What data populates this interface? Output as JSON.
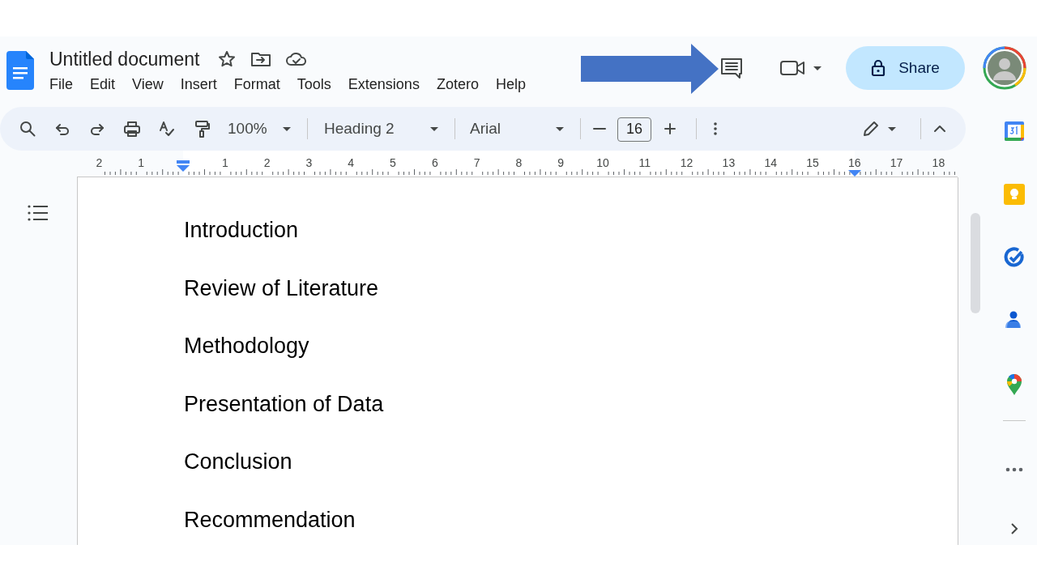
{
  "document": {
    "title": "Untitled document"
  },
  "menu": [
    "File",
    "Edit",
    "View",
    "Insert",
    "Format",
    "Tools",
    "Extensions",
    "Zotero",
    "Help"
  ],
  "share_button": {
    "label": "Share"
  },
  "toolbar": {
    "zoom": "100%",
    "style": "Heading 2",
    "font": "Arial",
    "font_size": "16"
  },
  "ruler": {
    "labels": [
      "2",
      "1",
      "1",
      "2",
      "3",
      "4",
      "5",
      "6",
      "7",
      "8",
      "9",
      "10",
      "11",
      "12",
      "13",
      "14",
      "15",
      "16",
      "17",
      "18"
    ]
  },
  "headings": [
    "Introduction",
    "Review of Literature",
    "Methodology",
    "Presentation of Data",
    "Conclusion",
    "Recommendation"
  ]
}
